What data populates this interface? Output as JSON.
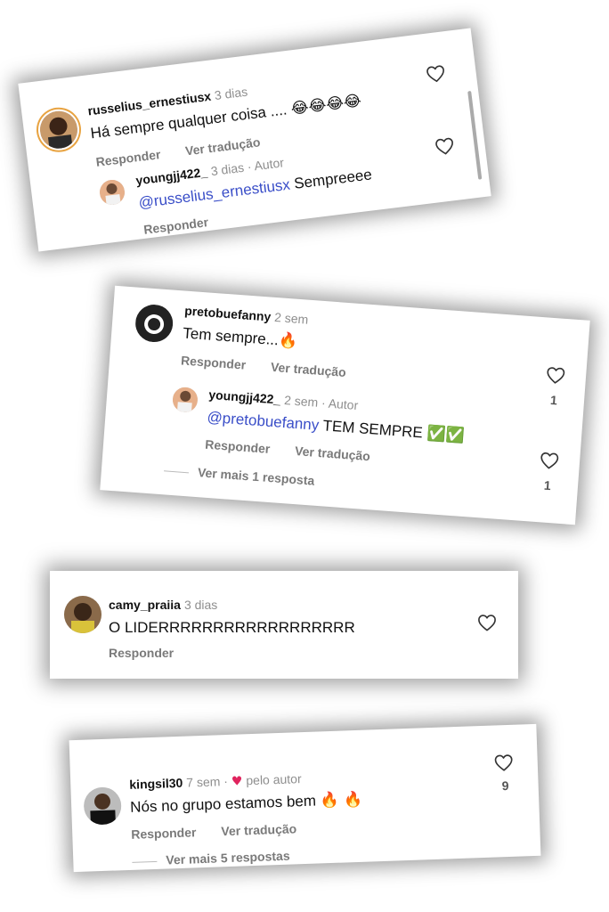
{
  "labels": {
    "reply": "Responder",
    "translate": "Ver tradução"
  },
  "card1": {
    "main": {
      "username": "russelius_ernestiusx",
      "time": "3 dias",
      "text": "Há sempre qualquer coisa ....",
      "emojis": "😂😂😂😂"
    },
    "reply": {
      "username": "youngjj422_",
      "time": "3 dias · Autor",
      "mention": "@russelius_ernestiusx",
      "text": " Sempreeee"
    }
  },
  "card2": {
    "main": {
      "username": "pretobuefanny",
      "time": "2 sem",
      "text": "Tem sempre...",
      "emoji": "🔥",
      "likes": "1"
    },
    "reply": {
      "username": "youngjj422_",
      "time": "2 sem · Autor",
      "mention": "@pretobuefanny",
      "text": " TEM SEMPRE",
      "emoji": "✅✅",
      "likes": "1"
    },
    "more": "Ver mais 1 resposta"
  },
  "card3": {
    "main": {
      "username": "camy_praiia",
      "time": "3 dias",
      "text": "O LIDERRRRRRRRRRRRRRRRRR"
    }
  },
  "card4": {
    "main": {
      "username": "kingsil30",
      "time": "7 sem ·",
      "heart": "♥",
      "liked_by": "pelo autor",
      "text": "Nós no grupo estamos bem",
      "emoji": "🔥 🔥",
      "likes": "9"
    },
    "more": "Ver mais 5 respostas"
  }
}
